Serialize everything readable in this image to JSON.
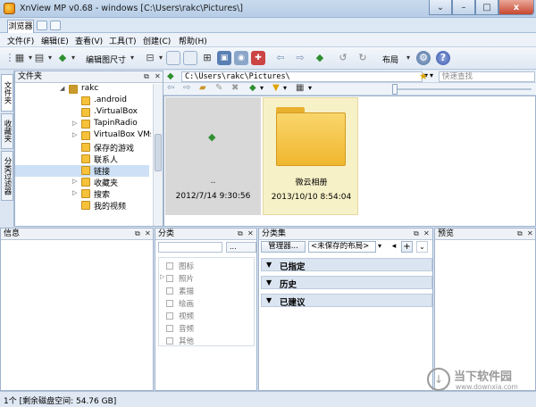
{
  "window": {
    "title": "XnView MP v0.68 - windows [C:\\Users\\rakc\\Pictures\\]",
    "minimize_label": "–",
    "maximize_label": "□",
    "close_label": "x",
    "extra_label": "⌄"
  },
  "tabs": {
    "active_label": "浏览器"
  },
  "menu": {
    "items": [
      {
        "label": "文件(F)"
      },
      {
        "label": "编辑(E)"
      },
      {
        "label": "查看(V)"
      },
      {
        "label": "工具(T)"
      },
      {
        "label": "创建(C)"
      },
      {
        "label": "帮助(H)"
      }
    ]
  },
  "toolbar": {
    "resize_label": "编辑图尺寸",
    "layout_label": "布局"
  },
  "side_tabs": {
    "folder": "文件夹",
    "favorites": "收藏夹",
    "filter": "分类过滤器"
  },
  "folder_panel": {
    "title": "文件夹",
    "items": [
      {
        "label": "rakc",
        "level": 0,
        "exp": "◢"
      },
      {
        "label": ".android",
        "level": 1,
        "exp": ""
      },
      {
        "label": ".VirtualBox",
        "level": 1,
        "exp": ""
      },
      {
        "label": "TapinRadio",
        "level": 1,
        "exp": "▷"
      },
      {
        "label": "VirtualBox VMs",
        "level": 1,
        "exp": "▷"
      },
      {
        "label": "保存的游戏",
        "level": 1,
        "exp": ""
      },
      {
        "label": "联系人",
        "level": 1,
        "exp": ""
      },
      {
        "label": "链接",
        "level": 1,
        "exp": ""
      },
      {
        "label": "收藏夹",
        "level": 1,
        "exp": "▷"
      },
      {
        "label": "搜索",
        "level": 1,
        "exp": "▷"
      },
      {
        "label": "我的视频",
        "level": 1,
        "exp": ""
      }
    ],
    "selected_index": 7
  },
  "address": {
    "path": "C:\\Users\\rakc\\Pictures\\",
    "search_placeholder": "快速查找"
  },
  "browser": {
    "items": [
      {
        "name": "..",
        "date": "2012/7/14 9:30:56"
      },
      {
        "name": "微云相册",
        "date": "2013/10/10 8:54:04"
      }
    ]
  },
  "info_panel": {
    "title": "信息"
  },
  "category_panel": {
    "title": "分类",
    "dropdown_label": "...",
    "items": [
      "图标",
      "照片",
      "素描",
      "绘画",
      "视频",
      "音频",
      "其他"
    ]
  },
  "catset_panel": {
    "title": "分类集",
    "manager_label": "管理器...",
    "layout_select": "<未保存的布局>",
    "add_label": "+",
    "groups": [
      "已指定",
      "历史",
      "已建议"
    ]
  },
  "preview_panel": {
    "title": "预览"
  },
  "status": {
    "text": "1个 [剩余磁盘空间: 54.76 GB]"
  },
  "watermark": {
    "brand": "当下软件园",
    "url": "www.downxia.com"
  },
  "colors": {
    "accent": "#3b6ea8",
    "folder": "#f6c23a",
    "selected": "#cde0f5",
    "thumb_selected": "#f7f1c8"
  }
}
